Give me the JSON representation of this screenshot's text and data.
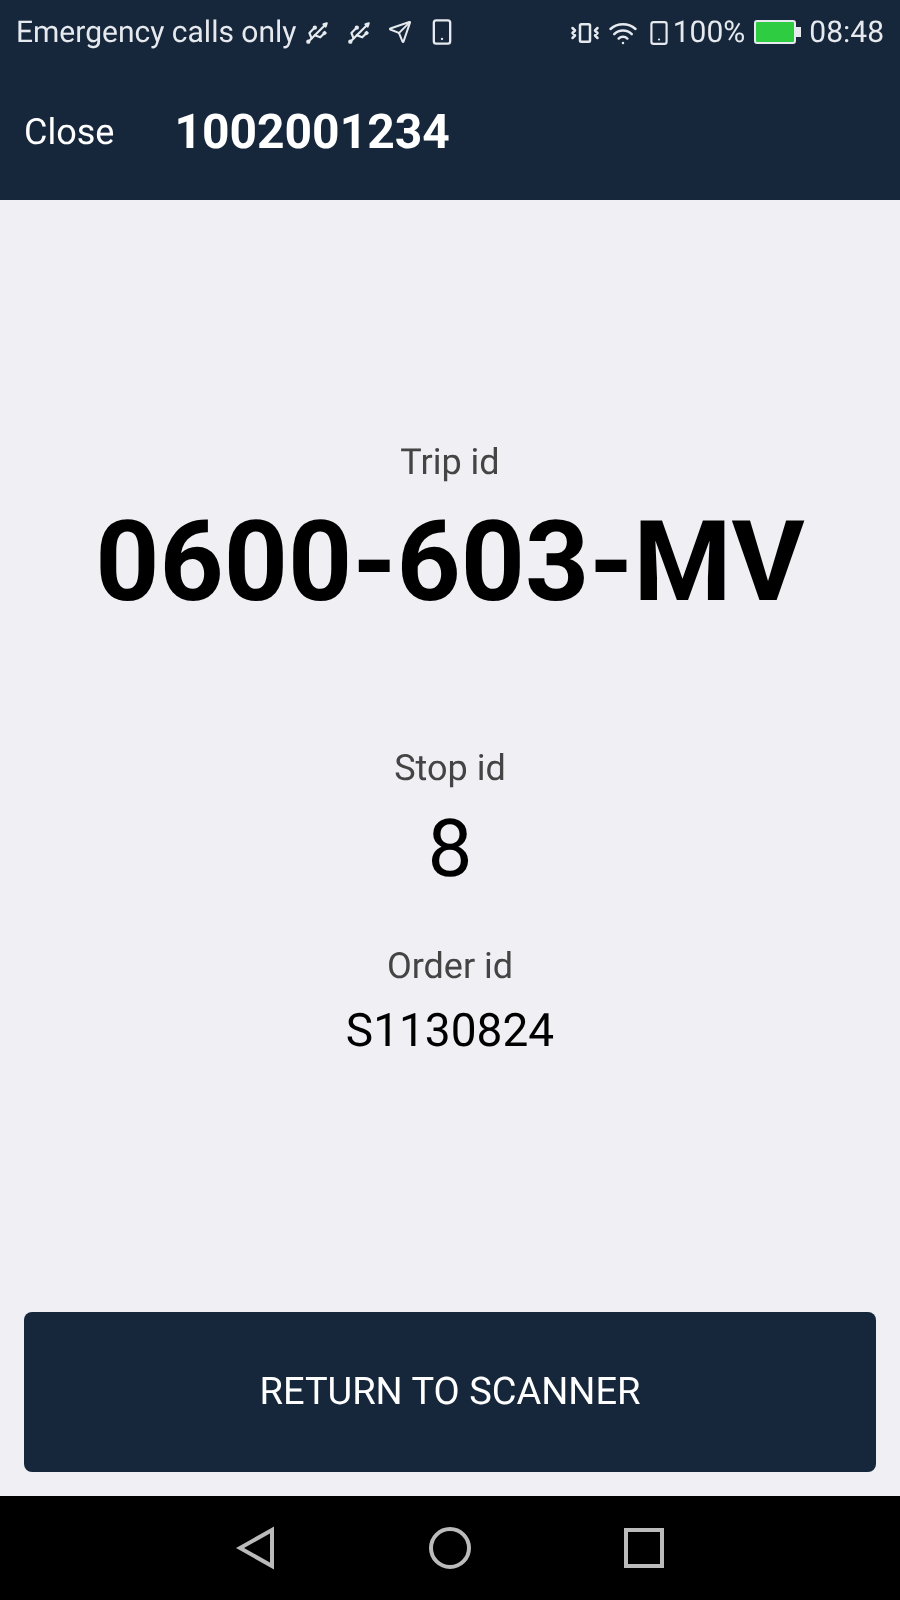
{
  "status_bar": {
    "carrier": "Emergency calls only",
    "battery": "100%",
    "time": "08:48"
  },
  "header": {
    "close": "Close",
    "title": "1002001234"
  },
  "fields": [
    {
      "label": "Trip id",
      "value": "0600-603-MV",
      "kind": "large"
    },
    {
      "label": "Stop id",
      "value": "8",
      "kind": "medium"
    },
    {
      "label": "Order id",
      "value": "S1130824",
      "kind": "small"
    }
  ],
  "button": "RETURN TO SCANNER"
}
